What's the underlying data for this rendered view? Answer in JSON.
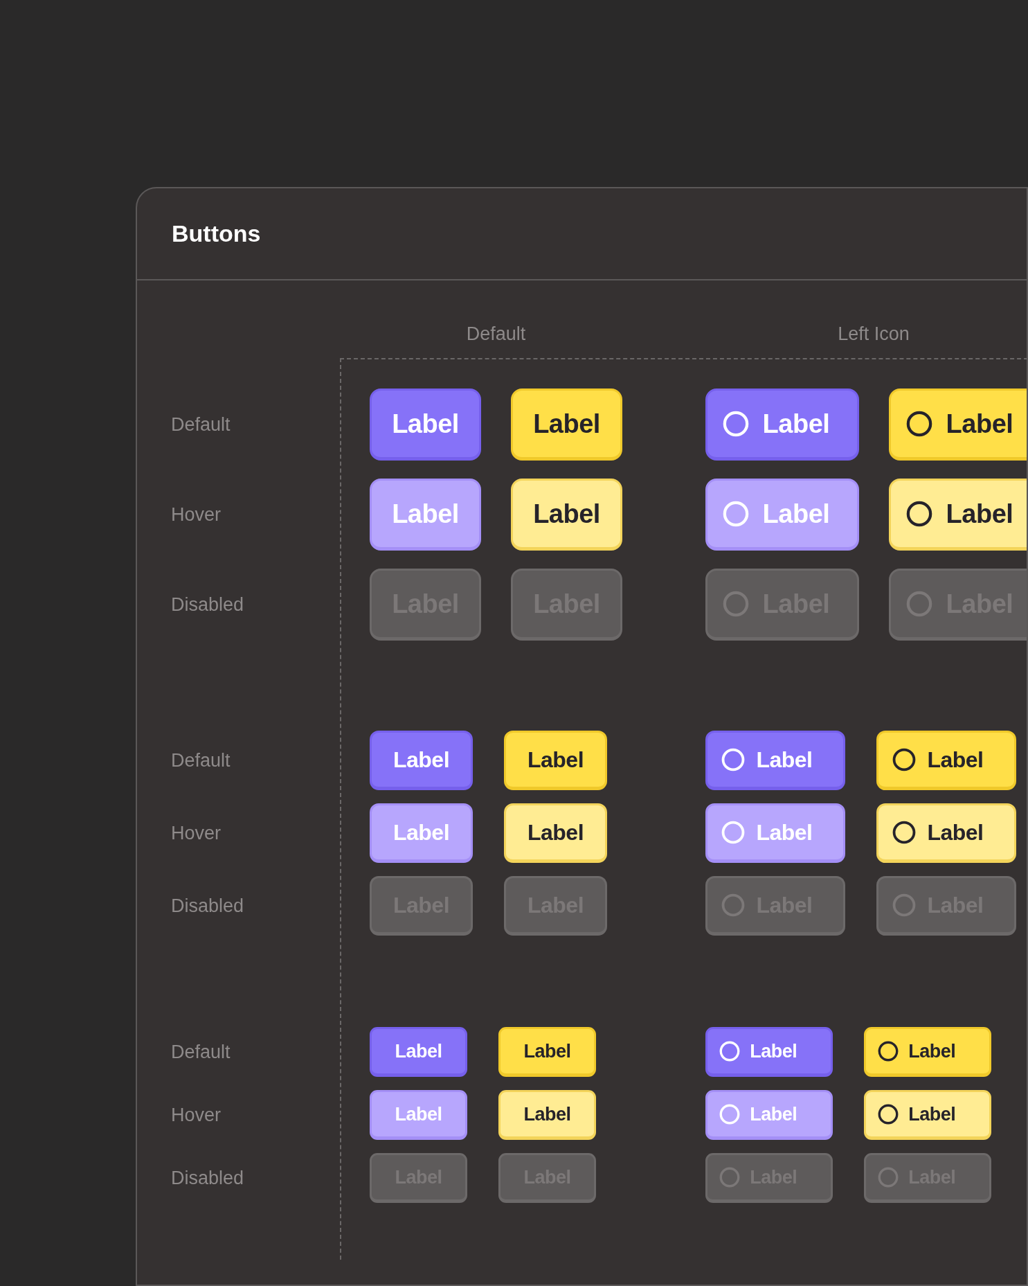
{
  "title": "Buttons",
  "columns": [
    "Default",
    "Left Icon"
  ],
  "sizes": [
    {
      "rows": [
        {
          "label": "Default",
          "hover": false,
          "disabled": false,
          "buttons": [
            "Label",
            "Label",
            "Label",
            "Label"
          ]
        },
        {
          "label": "Hover",
          "hover": true,
          "disabled": false,
          "buttons": [
            "Label",
            "Label",
            "Label",
            "Label"
          ]
        },
        {
          "label": "Disabled",
          "hover": false,
          "disabled": true,
          "buttons": [
            "Label",
            "Label",
            "Label",
            "Label"
          ]
        }
      ]
    },
    {
      "rows": [
        {
          "label": "Default",
          "hover": false,
          "disabled": false,
          "buttons": [
            "Label",
            "Label",
            "Label",
            "Label"
          ]
        },
        {
          "label": "Hover",
          "hover": true,
          "disabled": false,
          "buttons": [
            "Label",
            "Label",
            "Label",
            "Label"
          ]
        },
        {
          "label": "Disabled",
          "hover": false,
          "disabled": true,
          "buttons": [
            "Label",
            "Label",
            "Label",
            "Label"
          ]
        }
      ]
    },
    {
      "rows": [
        {
          "label": "Default",
          "hover": false,
          "disabled": false,
          "buttons": [
            "Label",
            "Label",
            "Label",
            "Label"
          ]
        },
        {
          "label": "Hover",
          "hover": true,
          "disabled": false,
          "buttons": [
            "Label",
            "Label",
            "Label",
            "Label"
          ]
        },
        {
          "label": "Disabled",
          "hover": false,
          "disabled": true,
          "buttons": [
            "Label",
            "Label",
            "Label",
            "Label"
          ]
        }
      ]
    }
  ]
}
